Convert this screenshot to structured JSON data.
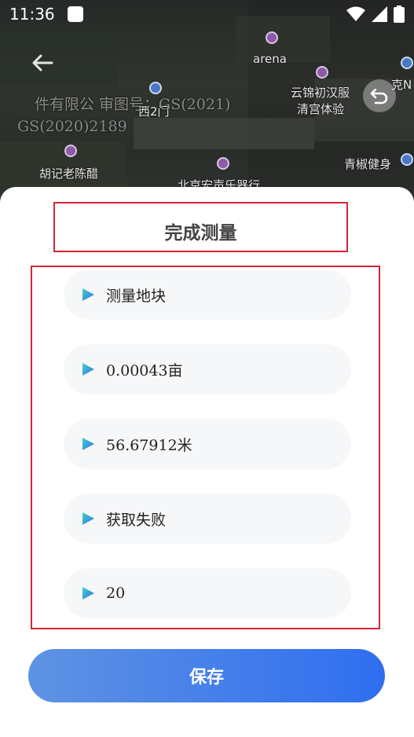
{
  "status_bar": {
    "time": "11:36"
  },
  "map": {
    "labels": {
      "arena": "arena",
      "west_gate": "西2门",
      "poi_yunjin_1": "云锦初汉服",
      "poi_yunjin_2": "清宫体验",
      "poi_right_edge": "克N",
      "poi_huji": "胡记老陈醋",
      "poi_qingjiao": "青椒健身",
      "poi_beijing": "北京宏声乐器行",
      "copyright_1": "件有限公  审图号：GS(2021)",
      "copyright_2": "GS(2020)2189"
    }
  },
  "sheet": {
    "title": "完成测量",
    "items": [
      {
        "text": "测量地块"
      },
      {
        "text": "0.00043亩"
      },
      {
        "text": "56.67912米"
      },
      {
        "text": "获取失败"
      },
      {
        "text": "20"
      }
    ],
    "save_label": "保存"
  },
  "colors": {
    "primary_start": "#5f93e3",
    "primary_end": "#2f6ef0",
    "highlight_border": "#d3253a",
    "item_bg": "#f6f7f9"
  },
  "icons": {
    "back": "arrow-left-icon",
    "undo": "undo-icon",
    "item_marker": "play-triangle-icon"
  }
}
